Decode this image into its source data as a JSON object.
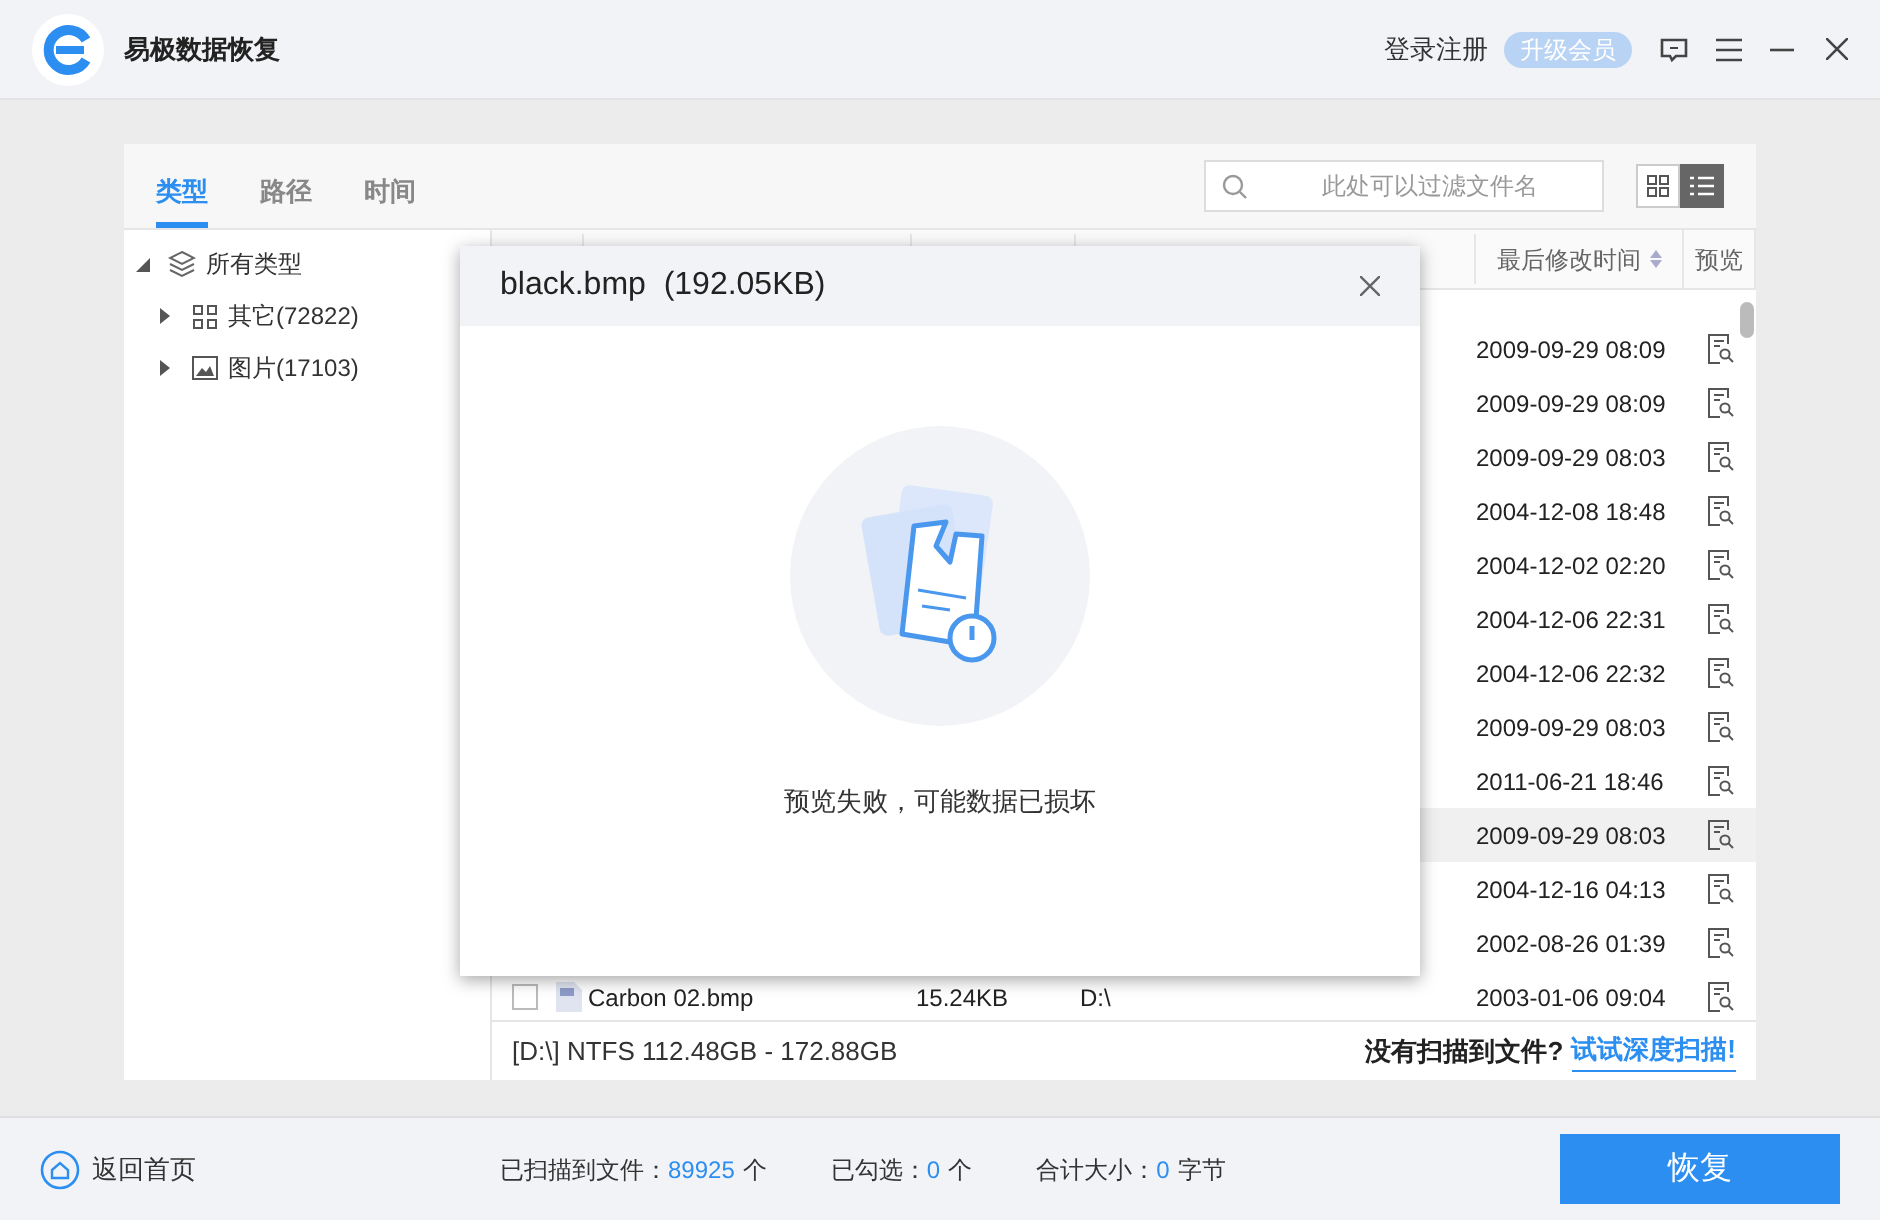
{
  "app": {
    "title": "易极数据恢复",
    "login": "登录注册",
    "upgrade": "升级会员"
  },
  "tabs": [
    {
      "label": "类型",
      "selected": true
    },
    {
      "label": "路径",
      "selected": false
    },
    {
      "label": "时间",
      "selected": false
    }
  ],
  "search": {
    "placeholder": "此处可以过滤文件名"
  },
  "view_toggle": [
    {
      "kind": "grid",
      "selected": false
    },
    {
      "kind": "list",
      "selected": true
    }
  ],
  "tree": [
    {
      "label": "所有类型",
      "kind": "layers",
      "expanded": true,
      "children": [
        {
          "label": "其它(72822)",
          "kind": "grid",
          "expanded": false
        },
        {
          "label": "图片(17103)",
          "kind": "image",
          "expanded": false
        }
      ]
    }
  ],
  "table": {
    "columns": [
      {
        "label": "最后修改时间",
        "sortable": true
      },
      {
        "label": "预览",
        "sortable": false
      }
    ],
    "rows": [
      {
        "modified": "2009-09-29 08:09",
        "highlighted": false
      },
      {
        "modified": "2009-09-29 08:09",
        "highlighted": false
      },
      {
        "modified": "2009-09-29 08:03",
        "highlighted": false
      },
      {
        "modified": "2004-12-08 18:48",
        "highlighted": false
      },
      {
        "modified": "2004-12-02 02:20",
        "highlighted": false
      },
      {
        "modified": "2004-12-06 22:31",
        "highlighted": false
      },
      {
        "modified": "2004-12-06 22:32",
        "highlighted": false
      },
      {
        "modified": "2009-09-29 08:03",
        "highlighted": false
      },
      {
        "modified": "2011-06-21 18:46",
        "highlighted": false
      },
      {
        "modified": "2009-09-29 08:03",
        "highlighted": true
      },
      {
        "modified": "2004-12-16 04:13",
        "highlighted": false
      },
      {
        "modified": "2002-08-26 01:39",
        "highlighted": false
      },
      {
        "name": "Carbon 02.bmp",
        "size": "15.24KB",
        "path": "D:\\",
        "modified": "2003-01-06 09:04",
        "checked": false,
        "highlighted": false
      }
    ]
  },
  "status_bar": {
    "disk": "[D:\\] NTFS 112.48GB - 172.88GB",
    "hint": "没有扫描到文件?",
    "link": "试试深度扫描!"
  },
  "dialog": {
    "title": "black.bmp  (192.05KB)",
    "message": "预览失败，可能数据已损坏"
  },
  "footer": {
    "home": "返回首页",
    "stats": [
      {
        "label": "已扫描到文件：",
        "value": "89925",
        "unit": "个"
      },
      {
        "label": "已勾选：",
        "value": "0",
        "unit": "个"
      },
      {
        "label": "合计大小：",
        "value": "0",
        "unit": "字节"
      }
    ],
    "recover": "恢复"
  }
}
